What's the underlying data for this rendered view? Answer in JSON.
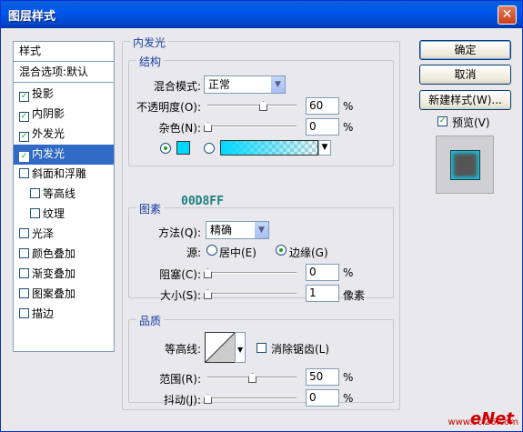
{
  "window": {
    "title": "图层样式",
    "close": "✕"
  },
  "sidebar": {
    "header": "样式",
    "blend": "混合选项:默认",
    "items": [
      {
        "label": "投影",
        "checked": true
      },
      {
        "label": "内阴影",
        "checked": true
      },
      {
        "label": "外发光",
        "checked": true
      },
      {
        "label": "内发光",
        "checked": true,
        "selected": true
      },
      {
        "label": "斜面和浮雕",
        "checked": false
      },
      {
        "label": "等高线",
        "checked": false,
        "indent": true
      },
      {
        "label": "纹理",
        "checked": false,
        "indent": true
      },
      {
        "label": "光泽",
        "checked": false
      },
      {
        "label": "颜色叠加",
        "checked": false
      },
      {
        "label": "渐变叠加",
        "checked": false
      },
      {
        "label": "图案叠加",
        "checked": false
      },
      {
        "label": "描边",
        "checked": false
      }
    ]
  },
  "inner_glow": {
    "title": "内发光",
    "structure": {
      "title": "结构",
      "blend_label": "混合模式:",
      "blend_value": "正常",
      "opacity_label": "不透明度(O):",
      "opacity": "60",
      "noise_label": "杂色(N):",
      "noise": "0",
      "percent": "%",
      "color_hex": "00D8FF"
    },
    "elements": {
      "title": "图素",
      "method_label": "方法(Q):",
      "method_value": "精确",
      "source_label": "源:",
      "center_label": "居中(E)",
      "edge_label": "边缘(G)",
      "choke_label": "阻塞(C):",
      "choke": "0",
      "size_label": "大小(S):",
      "size": "1",
      "size_unit": "像素",
      "percent": "%"
    },
    "quality": {
      "title": "品质",
      "contour_label": "等高线:",
      "antialias_label": "消除锯齿(L)",
      "range_label": "范围(R):",
      "range": "50",
      "jitter_label": "抖动(J):",
      "jitter": "0",
      "percent": "%"
    }
  },
  "buttons": {
    "ok": "确定",
    "cancel": "取消",
    "new_style": "新建样式(W)...",
    "preview": "预览(V)"
  },
  "colors": {
    "glow": "#00D8FF",
    "selection": "#316AC5"
  },
  "watermark": {
    "brand": "eNet",
    "site": "www.sci26.com"
  }
}
